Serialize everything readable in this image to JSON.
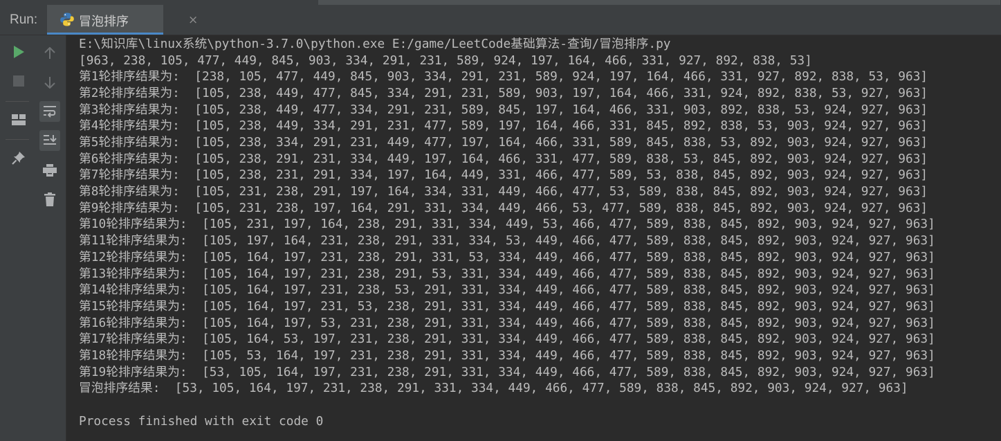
{
  "run_panel": {
    "label": "Run:",
    "tab": {
      "title": "冒泡排序",
      "close": "×"
    }
  },
  "toolbar": {
    "left": [
      {
        "name": "run-icon",
        "color": "#59a869"
      },
      {
        "name": "stop-icon",
        "color": "#5a5d5f"
      },
      {
        "name": "layout-icon",
        "color": "#afb1b3"
      },
      {
        "name": "pin-icon",
        "color": "#afb1b3"
      }
    ],
    "right": [
      {
        "name": "arrow-up-icon",
        "color": "#6e7173"
      },
      {
        "name": "arrow-down-icon",
        "color": "#6e7173"
      },
      {
        "name": "soft-wrap-icon",
        "color": "#afb1b3"
      },
      {
        "name": "scroll-to-end-icon",
        "color": "#afb1b3"
      },
      {
        "name": "print-icon",
        "color": "#afb1b3"
      },
      {
        "name": "trash-icon",
        "color": "#afb1b3"
      }
    ]
  },
  "console": {
    "lines": [
      "E:\\知识库\\linux系统\\python-3.7.0\\python.exe E:/game/LeetCode基础算法-查询/冒泡排序.py",
      "[963, 238, 105, 477, 449, 845, 903, 334, 291, 231, 589, 924, 197, 164, 466, 331, 927, 892, 838, 53]",
      "第1轮排序结果为:  [238, 105, 477, 449, 845, 903, 334, 291, 231, 589, 924, 197, 164, 466, 331, 927, 892, 838, 53, 963]",
      "第2轮排序结果为:  [105, 238, 449, 477, 845, 334, 291, 231, 589, 903, 197, 164, 466, 331, 924, 892, 838, 53, 927, 963]",
      "第3轮排序结果为:  [105, 238, 449, 477, 334, 291, 231, 589, 845, 197, 164, 466, 331, 903, 892, 838, 53, 924, 927, 963]",
      "第4轮排序结果为:  [105, 238, 449, 334, 291, 231, 477, 589, 197, 164, 466, 331, 845, 892, 838, 53, 903, 924, 927, 963]",
      "第5轮排序结果为:  [105, 238, 334, 291, 231, 449, 477, 197, 164, 466, 331, 589, 845, 838, 53, 892, 903, 924, 927, 963]",
      "第6轮排序结果为:  [105, 238, 291, 231, 334, 449, 197, 164, 466, 331, 477, 589, 838, 53, 845, 892, 903, 924, 927, 963]",
      "第7轮排序结果为:  [105, 238, 231, 291, 334, 197, 164, 449, 331, 466, 477, 589, 53, 838, 845, 892, 903, 924, 927, 963]",
      "第8轮排序结果为:  [105, 231, 238, 291, 197, 164, 334, 331, 449, 466, 477, 53, 589, 838, 845, 892, 903, 924, 927, 963]",
      "第9轮排序结果为:  [105, 231, 238, 197, 164, 291, 331, 334, 449, 466, 53, 477, 589, 838, 845, 892, 903, 924, 927, 963]",
      "第10轮排序结果为:  [105, 231, 197, 164, 238, 291, 331, 334, 449, 53, 466, 477, 589, 838, 845, 892, 903, 924, 927, 963]",
      "第11轮排序结果为:  [105, 197, 164, 231, 238, 291, 331, 334, 53, 449, 466, 477, 589, 838, 845, 892, 903, 924, 927, 963]",
      "第12轮排序结果为:  [105, 164, 197, 231, 238, 291, 331, 53, 334, 449, 466, 477, 589, 838, 845, 892, 903, 924, 927, 963]",
      "第13轮排序结果为:  [105, 164, 197, 231, 238, 291, 53, 331, 334, 449, 466, 477, 589, 838, 845, 892, 903, 924, 927, 963]",
      "第14轮排序结果为:  [105, 164, 197, 231, 238, 53, 291, 331, 334, 449, 466, 477, 589, 838, 845, 892, 903, 924, 927, 963]",
      "第15轮排序结果为:  [105, 164, 197, 231, 53, 238, 291, 331, 334, 449, 466, 477, 589, 838, 845, 892, 903, 924, 927, 963]",
      "第16轮排序结果为:  [105, 164, 197, 53, 231, 238, 291, 331, 334, 449, 466, 477, 589, 838, 845, 892, 903, 924, 927, 963]",
      "第17轮排序结果为:  [105, 164, 53, 197, 231, 238, 291, 331, 334, 449, 466, 477, 589, 838, 845, 892, 903, 924, 927, 963]",
      "第18轮排序结果为:  [105, 53, 164, 197, 231, 238, 291, 331, 334, 449, 466, 477, 589, 838, 845, 892, 903, 924, 927, 963]",
      "第19轮排序结果为:  [53, 105, 164, 197, 231, 238, 291, 331, 334, 449, 466, 477, 589, 838, 845, 892, 903, 924, 927, 963]",
      "冒泡排序结果:  [53, 105, 164, 197, 231, 238, 291, 331, 334, 449, 466, 477, 589, 838, 845, 892, 903, 924, 927, 963]",
      "",
      "Process finished with exit code 0"
    ]
  }
}
